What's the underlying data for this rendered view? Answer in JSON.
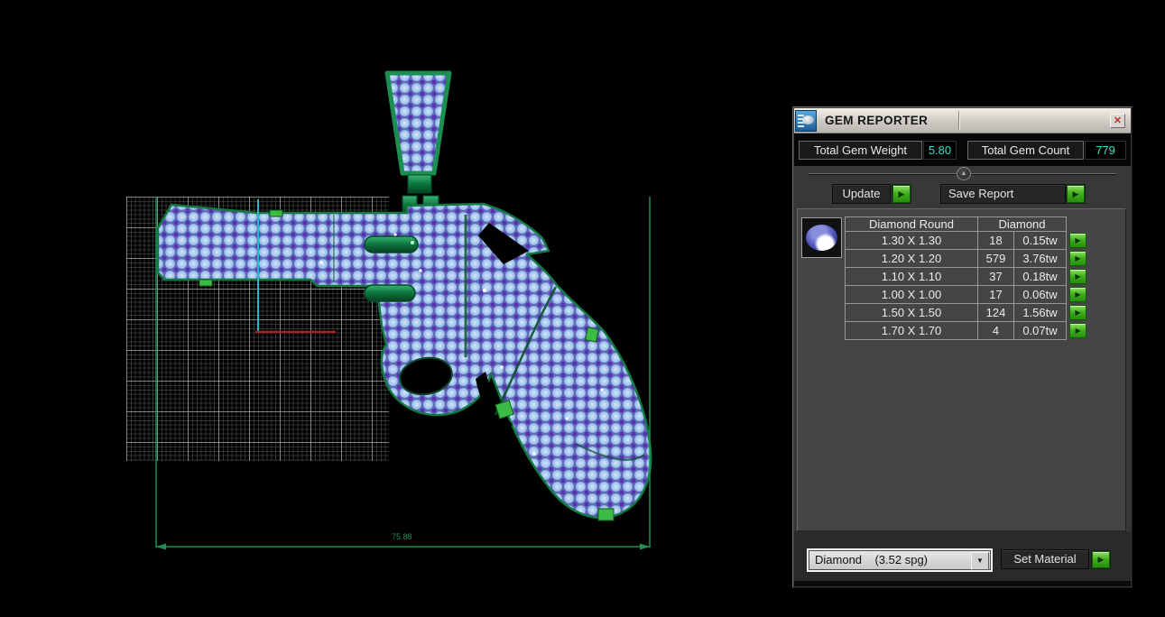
{
  "icons": {
    "close": "✕",
    "play": "▶",
    "dropdown_arrow": "▼",
    "slider_handle": "▲"
  },
  "viewport": {
    "dimension_label": "75.88"
  },
  "panel": {
    "title": "GEM REPORTER",
    "totals": {
      "weight_label": "Total Gem Weight",
      "weight_value": "5.80",
      "count_label": "Total Gem Count",
      "count_value": "779"
    },
    "buttons": {
      "update": "Update",
      "save_report": "Save Report",
      "set_material": "Set Material"
    },
    "table": {
      "shape_header": "Diamond Round",
      "material_header": "Diamond",
      "rows": [
        {
          "size": "1.30 X 1.30",
          "count": "18",
          "weight": "0.15tw"
        },
        {
          "size": "1.20 X 1.20",
          "count": "579",
          "weight": "3.76tw"
        },
        {
          "size": "1.10 X 1.10",
          "count": "37",
          "weight": "0.18tw"
        },
        {
          "size": "1.00 X 1.00",
          "count": "17",
          "weight": "0.06tw"
        },
        {
          "size": "1.50 X 1.50",
          "count": "124",
          "weight": "1.56tw"
        },
        {
          "size": "1.70 X 1.70",
          "count": "4",
          "weight": "0.07tw"
        }
      ]
    },
    "material_dropdown": {
      "value": "Diamond    (3.52 spg)"
    }
  },
  "colors": {
    "accent_green": "#3fae1e",
    "value_cyan": "#35e2cc",
    "dimension_green": "#1e9052",
    "gem_blue": "#a7c6f0",
    "outline_green": "#137a44"
  }
}
